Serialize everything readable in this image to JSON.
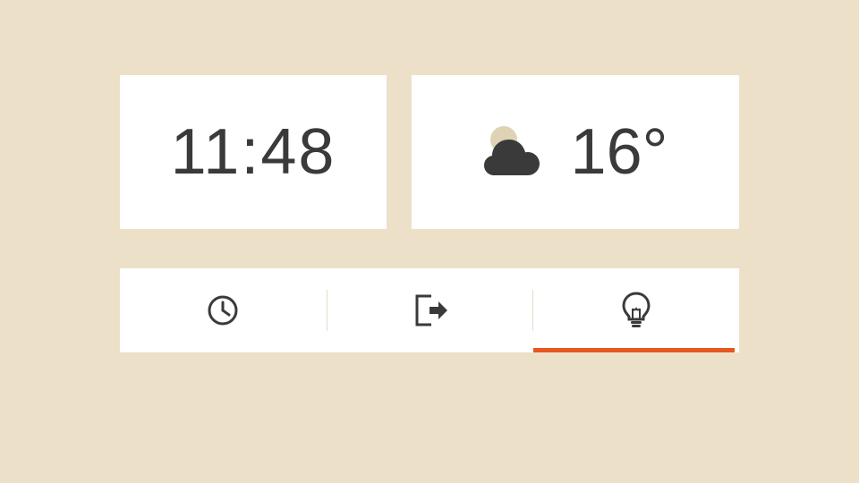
{
  "time": {
    "value": "11:48"
  },
  "weather": {
    "condition": "partly-cloudy",
    "temperature": "16°"
  },
  "launcher": {
    "items": [
      {
        "name": "clock",
        "icon": "clock-icon",
        "active": false
      },
      {
        "name": "leave",
        "icon": "exit-icon",
        "active": false
      },
      {
        "name": "ideas",
        "icon": "lightbulb-icon",
        "active": true
      }
    ]
  }
}
